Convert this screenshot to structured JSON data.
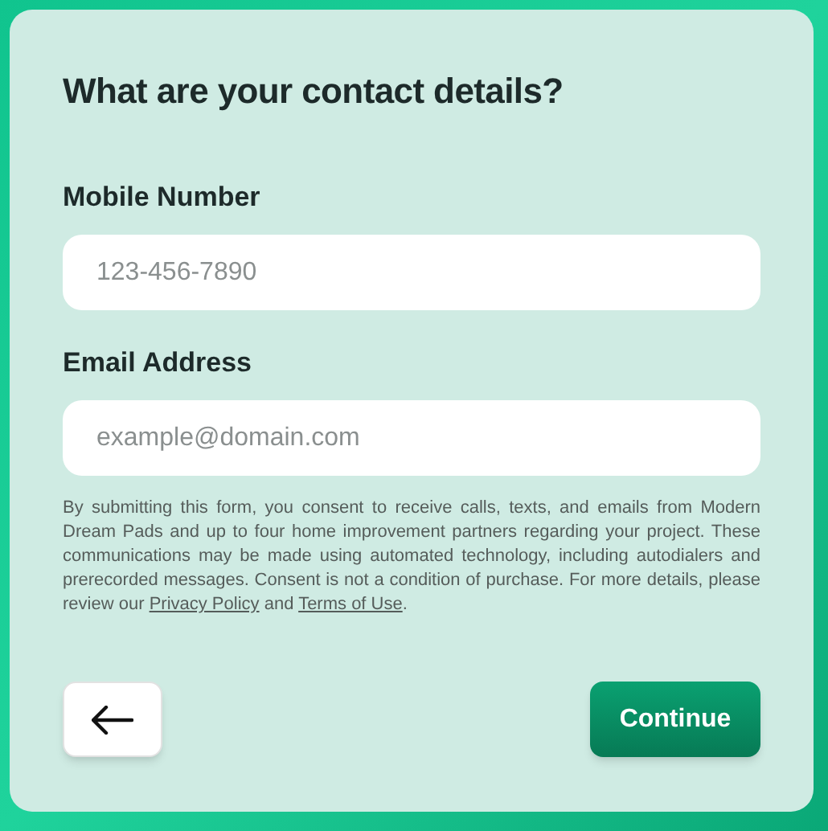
{
  "title": "What are your contact details?",
  "fields": [
    {
      "label": "Mobile Number",
      "placeholder": "123-456-7890"
    },
    {
      "label": "Email Address",
      "placeholder": "example@domain.com"
    }
  ],
  "consent": {
    "text": "By submitting this form, you consent to receive calls, texts, and emails from Modern Dream Pads and up to four home improvement partners regarding your project. These communications may be made using automated technology, including autodialers and prerecorded messages. Consent is not a condition of purchase. For more details, please review our",
    "privacy_link": "Privacy Policy",
    "joiner": "and",
    "terms_link": "Terms of Use",
    "end": "."
  },
  "continue_button": "Continue"
}
